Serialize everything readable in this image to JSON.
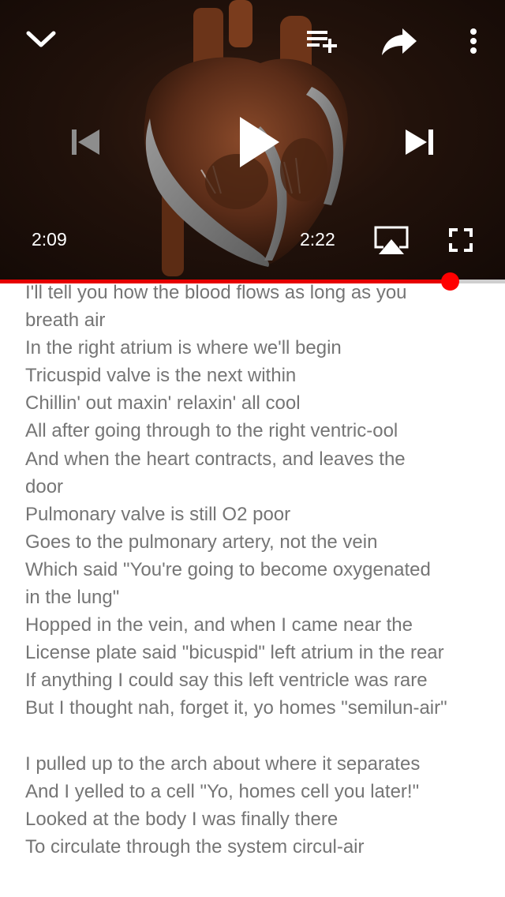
{
  "player": {
    "current_time": "2:09",
    "duration": "2:22",
    "progress_fraction": 0.891,
    "icons": {
      "minimize": "chevron-down-icon",
      "add_to_playlist": "playlist-add-icon",
      "share": "share-icon",
      "more": "more-vertical-icon",
      "previous": "skip-previous-icon",
      "play": "play-icon",
      "next": "skip-next-icon",
      "airplay": "airplay-icon",
      "fullscreen": "fullscreen-icon"
    },
    "colors": {
      "progress": "#e60000",
      "progress_thumb": "#ff0000",
      "track": "#cfcfcf"
    }
  },
  "lyrics": {
    "lines": [
      "I'll tell you how the blood flows as long as you",
      "breath air",
      "In the right atrium is where we'll begin",
      "Tricuspid valve is the next within",
      "Chillin' out maxin' relaxin' all cool",
      "All after going through to the right ventric-ool",
      "And when the heart contracts, and leaves the",
      "door",
      "Pulmonary valve is still O2 poor",
      "Goes to the pulmonary artery, not the vein",
      "Which said \"You're going to become oxygenated",
      "in the lung\"",
      "Hopped in the vein, and when I came near the",
      "License plate said \"bicuspid\" left atrium in the rear",
      "If anything I could say this left ventricle was rare",
      "But I thought nah, forget it, yo homes \"semilun-air\"",
      "",
      "I pulled up to the arch about where it separates",
      "And I yelled to a cell \"Yo, homes cell you later!\"",
      "Looked at the body I was finally there",
      "To circulate through the system circul-air"
    ]
  }
}
